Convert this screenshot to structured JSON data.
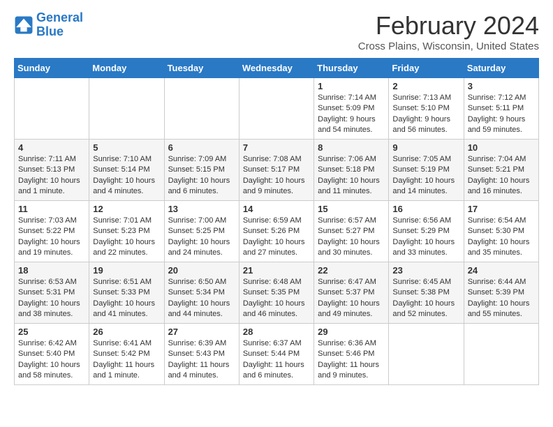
{
  "logo": {
    "line1": "General",
    "line2": "Blue"
  },
  "title": "February 2024",
  "location": "Cross Plains, Wisconsin, United States",
  "days_of_week": [
    "Sunday",
    "Monday",
    "Tuesday",
    "Wednesday",
    "Thursday",
    "Friday",
    "Saturday"
  ],
  "weeks": [
    [
      {
        "day": "",
        "content": ""
      },
      {
        "day": "",
        "content": ""
      },
      {
        "day": "",
        "content": ""
      },
      {
        "day": "",
        "content": ""
      },
      {
        "day": "1",
        "content": "Sunrise: 7:14 AM\nSunset: 5:09 PM\nDaylight: 9 hours\nand 54 minutes."
      },
      {
        "day": "2",
        "content": "Sunrise: 7:13 AM\nSunset: 5:10 PM\nDaylight: 9 hours\nand 56 minutes."
      },
      {
        "day": "3",
        "content": "Sunrise: 7:12 AM\nSunset: 5:11 PM\nDaylight: 9 hours\nand 59 minutes."
      }
    ],
    [
      {
        "day": "4",
        "content": "Sunrise: 7:11 AM\nSunset: 5:13 PM\nDaylight: 10 hours\nand 1 minute."
      },
      {
        "day": "5",
        "content": "Sunrise: 7:10 AM\nSunset: 5:14 PM\nDaylight: 10 hours\nand 4 minutes."
      },
      {
        "day": "6",
        "content": "Sunrise: 7:09 AM\nSunset: 5:15 PM\nDaylight: 10 hours\nand 6 minutes."
      },
      {
        "day": "7",
        "content": "Sunrise: 7:08 AM\nSunset: 5:17 PM\nDaylight: 10 hours\nand 9 minutes."
      },
      {
        "day": "8",
        "content": "Sunrise: 7:06 AM\nSunset: 5:18 PM\nDaylight: 10 hours\nand 11 minutes."
      },
      {
        "day": "9",
        "content": "Sunrise: 7:05 AM\nSunset: 5:19 PM\nDaylight: 10 hours\nand 14 minutes."
      },
      {
        "day": "10",
        "content": "Sunrise: 7:04 AM\nSunset: 5:21 PM\nDaylight: 10 hours\nand 16 minutes."
      }
    ],
    [
      {
        "day": "11",
        "content": "Sunrise: 7:03 AM\nSunset: 5:22 PM\nDaylight: 10 hours\nand 19 minutes."
      },
      {
        "day": "12",
        "content": "Sunrise: 7:01 AM\nSunset: 5:23 PM\nDaylight: 10 hours\nand 22 minutes."
      },
      {
        "day": "13",
        "content": "Sunrise: 7:00 AM\nSunset: 5:25 PM\nDaylight: 10 hours\nand 24 minutes."
      },
      {
        "day": "14",
        "content": "Sunrise: 6:59 AM\nSunset: 5:26 PM\nDaylight: 10 hours\nand 27 minutes."
      },
      {
        "day": "15",
        "content": "Sunrise: 6:57 AM\nSunset: 5:27 PM\nDaylight: 10 hours\nand 30 minutes."
      },
      {
        "day": "16",
        "content": "Sunrise: 6:56 AM\nSunset: 5:29 PM\nDaylight: 10 hours\nand 33 minutes."
      },
      {
        "day": "17",
        "content": "Sunrise: 6:54 AM\nSunset: 5:30 PM\nDaylight: 10 hours\nand 35 minutes."
      }
    ],
    [
      {
        "day": "18",
        "content": "Sunrise: 6:53 AM\nSunset: 5:31 PM\nDaylight: 10 hours\nand 38 minutes."
      },
      {
        "day": "19",
        "content": "Sunrise: 6:51 AM\nSunset: 5:33 PM\nDaylight: 10 hours\nand 41 minutes."
      },
      {
        "day": "20",
        "content": "Sunrise: 6:50 AM\nSunset: 5:34 PM\nDaylight: 10 hours\nand 44 minutes."
      },
      {
        "day": "21",
        "content": "Sunrise: 6:48 AM\nSunset: 5:35 PM\nDaylight: 10 hours\nand 46 minutes."
      },
      {
        "day": "22",
        "content": "Sunrise: 6:47 AM\nSunset: 5:37 PM\nDaylight: 10 hours\nand 49 minutes."
      },
      {
        "day": "23",
        "content": "Sunrise: 6:45 AM\nSunset: 5:38 PM\nDaylight: 10 hours\nand 52 minutes."
      },
      {
        "day": "24",
        "content": "Sunrise: 6:44 AM\nSunset: 5:39 PM\nDaylight: 10 hours\nand 55 minutes."
      }
    ],
    [
      {
        "day": "25",
        "content": "Sunrise: 6:42 AM\nSunset: 5:40 PM\nDaylight: 10 hours\nand 58 minutes."
      },
      {
        "day": "26",
        "content": "Sunrise: 6:41 AM\nSunset: 5:42 PM\nDaylight: 11 hours\nand 1 minute."
      },
      {
        "day": "27",
        "content": "Sunrise: 6:39 AM\nSunset: 5:43 PM\nDaylight: 11 hours\nand 4 minutes."
      },
      {
        "day": "28",
        "content": "Sunrise: 6:37 AM\nSunset: 5:44 PM\nDaylight: 11 hours\nand 6 minutes."
      },
      {
        "day": "29",
        "content": "Sunrise: 6:36 AM\nSunset: 5:46 PM\nDaylight: 11 hours\nand 9 minutes."
      },
      {
        "day": "",
        "content": ""
      },
      {
        "day": "",
        "content": ""
      }
    ]
  ]
}
